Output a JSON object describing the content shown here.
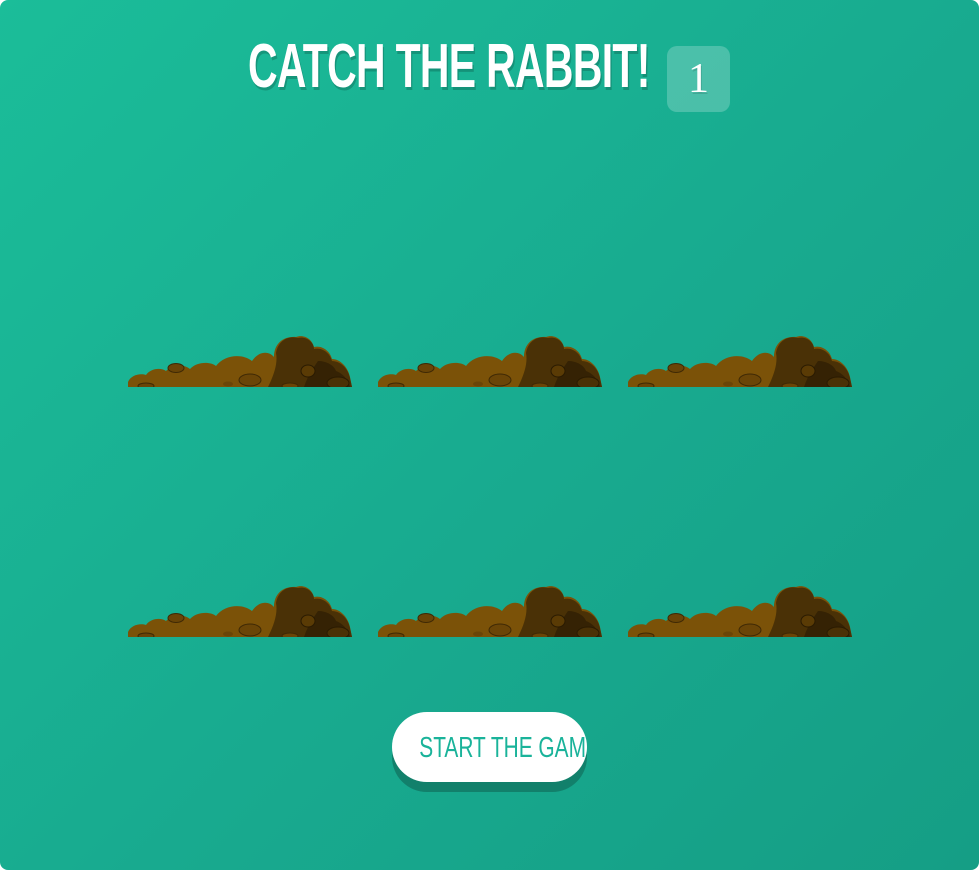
{
  "header": {
    "title": "CATCH THE RABBIT!",
    "score": "1"
  },
  "board": {
    "holes": [
      {
        "id": "hole-1"
      },
      {
        "id": "hole-2"
      },
      {
        "id": "hole-3"
      },
      {
        "id": "hole-4"
      },
      {
        "id": "hole-5"
      },
      {
        "id": "hole-6"
      }
    ]
  },
  "controls": {
    "start_label": "START THE GAME"
  },
  "colors": {
    "background": "#1bbd99",
    "dirt_light": "#7b5208",
    "dirt_dark": "#3f2905",
    "button_text": "#1ab39a",
    "button_shadow": "#12806b"
  }
}
